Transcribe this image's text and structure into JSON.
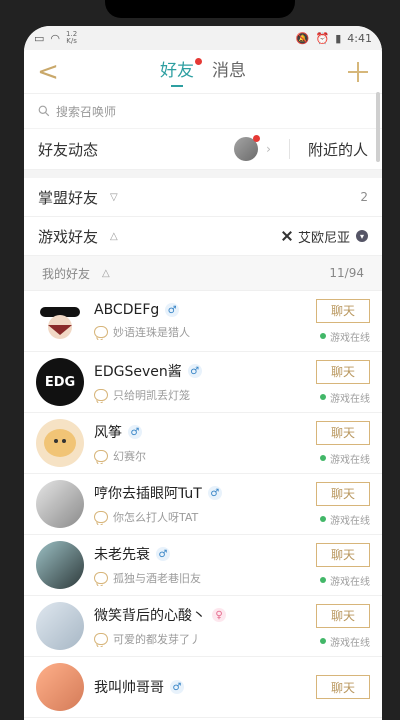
{
  "status": {
    "left_top": "1.2",
    "left_bottom": "K/s",
    "time": "4:41",
    "battery": "▮"
  },
  "colors": {
    "accent": "#2e9fa1",
    "gold": "#d7b57a",
    "online": "#42b768",
    "red": "#e53935"
  },
  "header": {
    "back_label": "<",
    "tab_friends": "好友",
    "tab_messages": "消息"
  },
  "search": {
    "placeholder": "搜索召唤师"
  },
  "quick": {
    "friend_dynamic": "好友动态",
    "nearby": "附近的人"
  },
  "groups": {
    "zhangmeng": "掌盟好友",
    "zhangmeng_count": "2",
    "game": "游戏好友",
    "region": "艾欧尼亚"
  },
  "my_friends": {
    "label": "我的好友",
    "count": "11/94"
  },
  "friends": [
    {
      "name": "ABCDEFg",
      "sex": "♂",
      "sign": "妙语连珠是猎人",
      "chat": "聊天",
      "status": "游戏在线"
    },
    {
      "name": "EDGSeven酱",
      "sex": "♂",
      "sign": "只给明凯丢灯笼",
      "chat": "聊天",
      "status": "游戏在线"
    },
    {
      "name": "风筝",
      "sex": "♂",
      "sign": "幻赛尔",
      "chat": "聊天",
      "status": "游戏在线"
    },
    {
      "name": "哼你去插眼阿TuT",
      "sex": "♂",
      "sign": "你怎么打人呀TAT",
      "chat": "聊天",
      "status": "游戏在线"
    },
    {
      "name": "未老先衰",
      "sex": "♂",
      "sign": "孤独与酒老巷旧友",
      "chat": "聊天",
      "status": "游戏在线"
    },
    {
      "name": "微笑背后的心酸丶",
      "sex": "♀",
      "sign": "可爱的都发芽了丿",
      "chat": "聊天",
      "status": "游戏在线"
    },
    {
      "name": "我叫帅哥哥",
      "sex": "♂",
      "sign": "",
      "chat": "聊天",
      "status": ""
    }
  ],
  "edg_text": "EDG"
}
